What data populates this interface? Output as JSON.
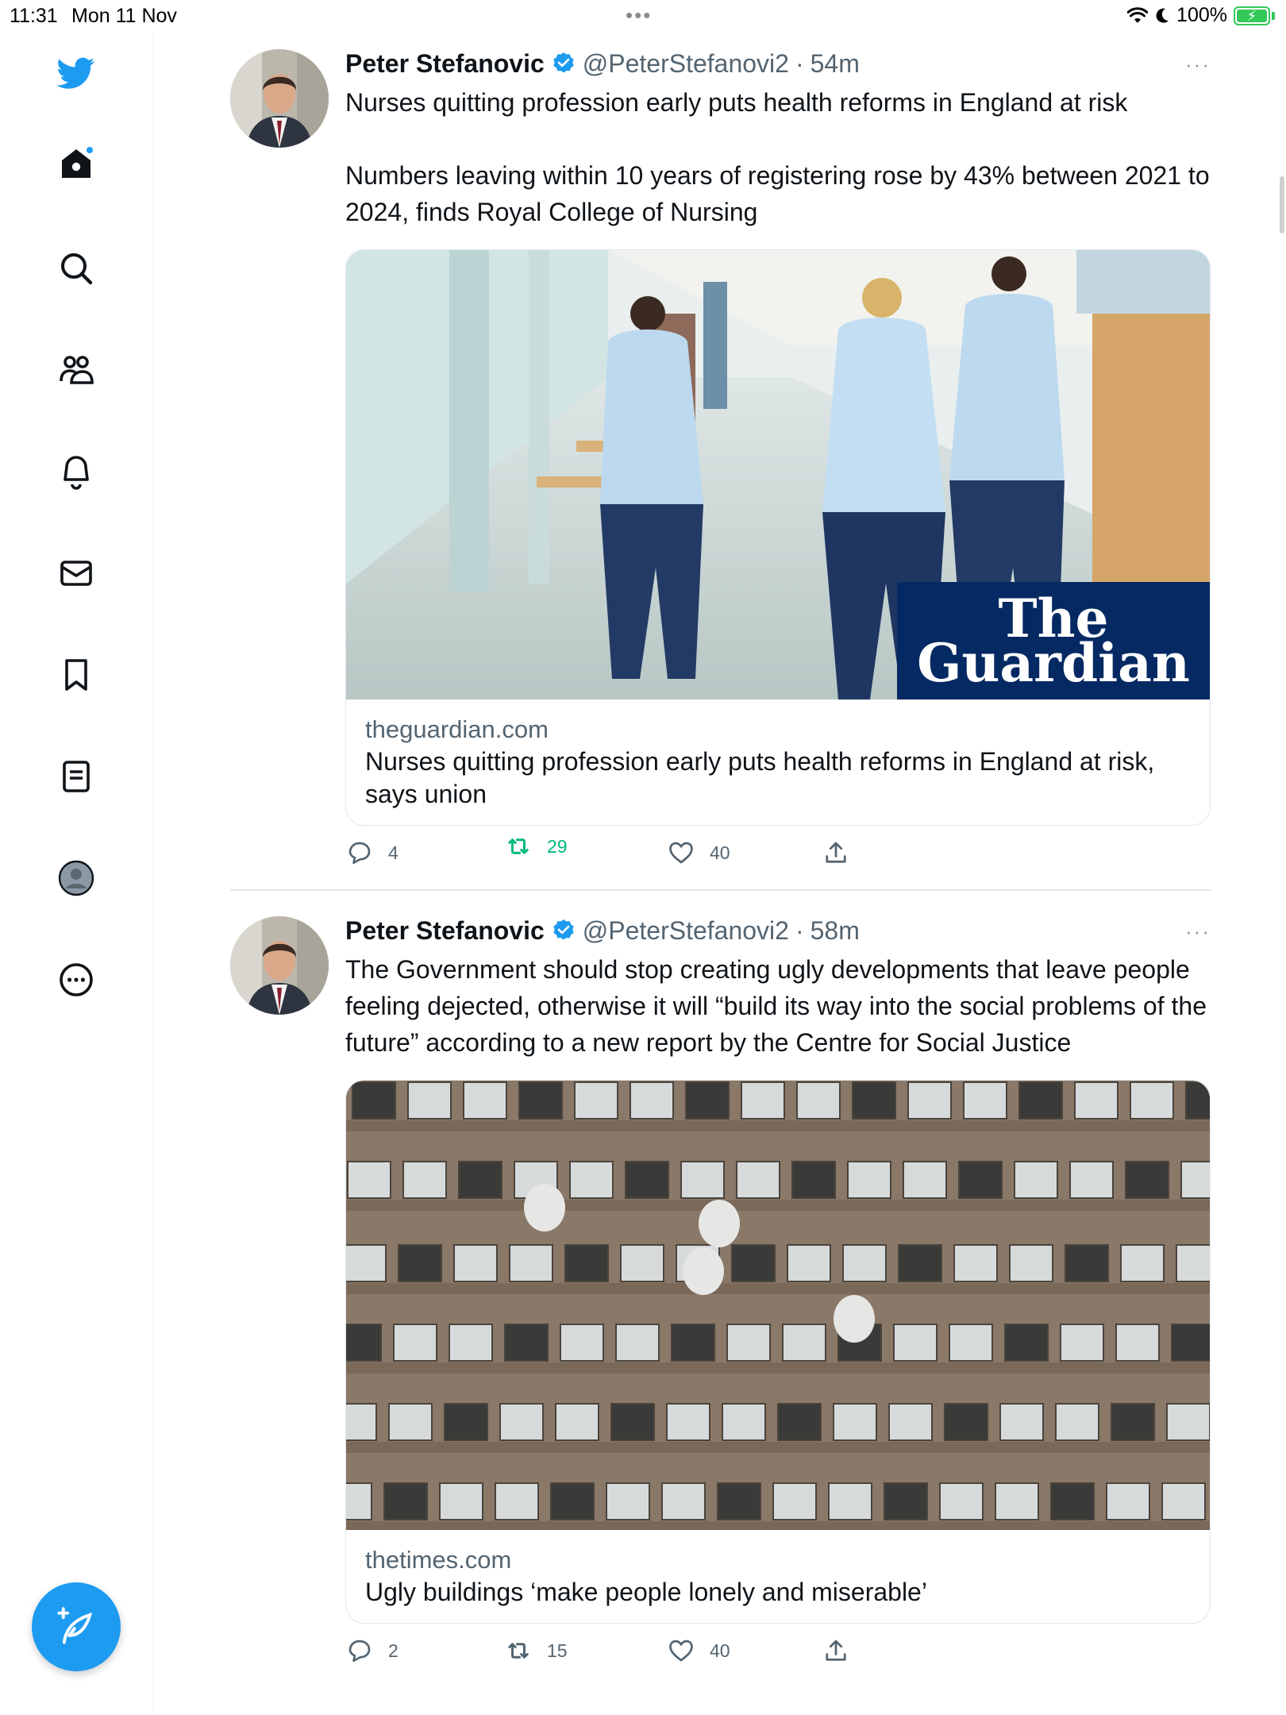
{
  "status_bar": {
    "time": "11:31",
    "date": "Mon 11 Nov",
    "battery": "100%",
    "multitask_dots": "•••"
  },
  "sidebar": {
    "items": [
      {
        "name": "twitter-logo-icon"
      },
      {
        "name": "home-icon",
        "notification_dot": true
      },
      {
        "name": "search-icon"
      },
      {
        "name": "communities-icon"
      },
      {
        "name": "notifications-icon"
      },
      {
        "name": "messages-icon"
      },
      {
        "name": "bookmarks-icon"
      },
      {
        "name": "lists-icon"
      },
      {
        "name": "profile-icon"
      },
      {
        "name": "more-icon"
      }
    ],
    "compose_icon": "compose-tweet-icon"
  },
  "colors": {
    "accent": "#1d9bf0",
    "retweet_active": "#00ba7c",
    "secondary_text": "#536471",
    "guardian_navy": "#052962"
  },
  "tweets": [
    {
      "author_name": "Peter Stefanovic",
      "handle": "@PeterStefanovi2",
      "separator": "·",
      "time": "54m",
      "more": "···",
      "text": "Nurses quitting profession early puts health reforms in England at risk\n\nNumbers leaving within 10 years of registering rose by 43% between 2021 to 2024, finds Royal College of Nursing",
      "card": {
        "domain": "theguardian.com",
        "title": "Nurses quitting profession early puts health reforms in England at risk, says union",
        "image_badge": [
          "The",
          "Guardian"
        ]
      },
      "replies": "4",
      "retweets": "29",
      "retweeted": true,
      "likes": "40"
    },
    {
      "author_name": "Peter Stefanovic",
      "handle": "@PeterStefanovi2",
      "separator": "·",
      "time": "58m",
      "more": "···",
      "text": "The Government should stop creating ugly developments that leave people feeling dejected, otherwise it will “build its way into the social problems of the future” according to a new report by the Centre for Social Justice",
      "card": {
        "domain": "thetimes.com",
        "title": "Ugly buildings ‘make people lonely and miserable’"
      },
      "replies": "2",
      "retweets": "15",
      "retweeted": false,
      "likes": "40"
    }
  ]
}
